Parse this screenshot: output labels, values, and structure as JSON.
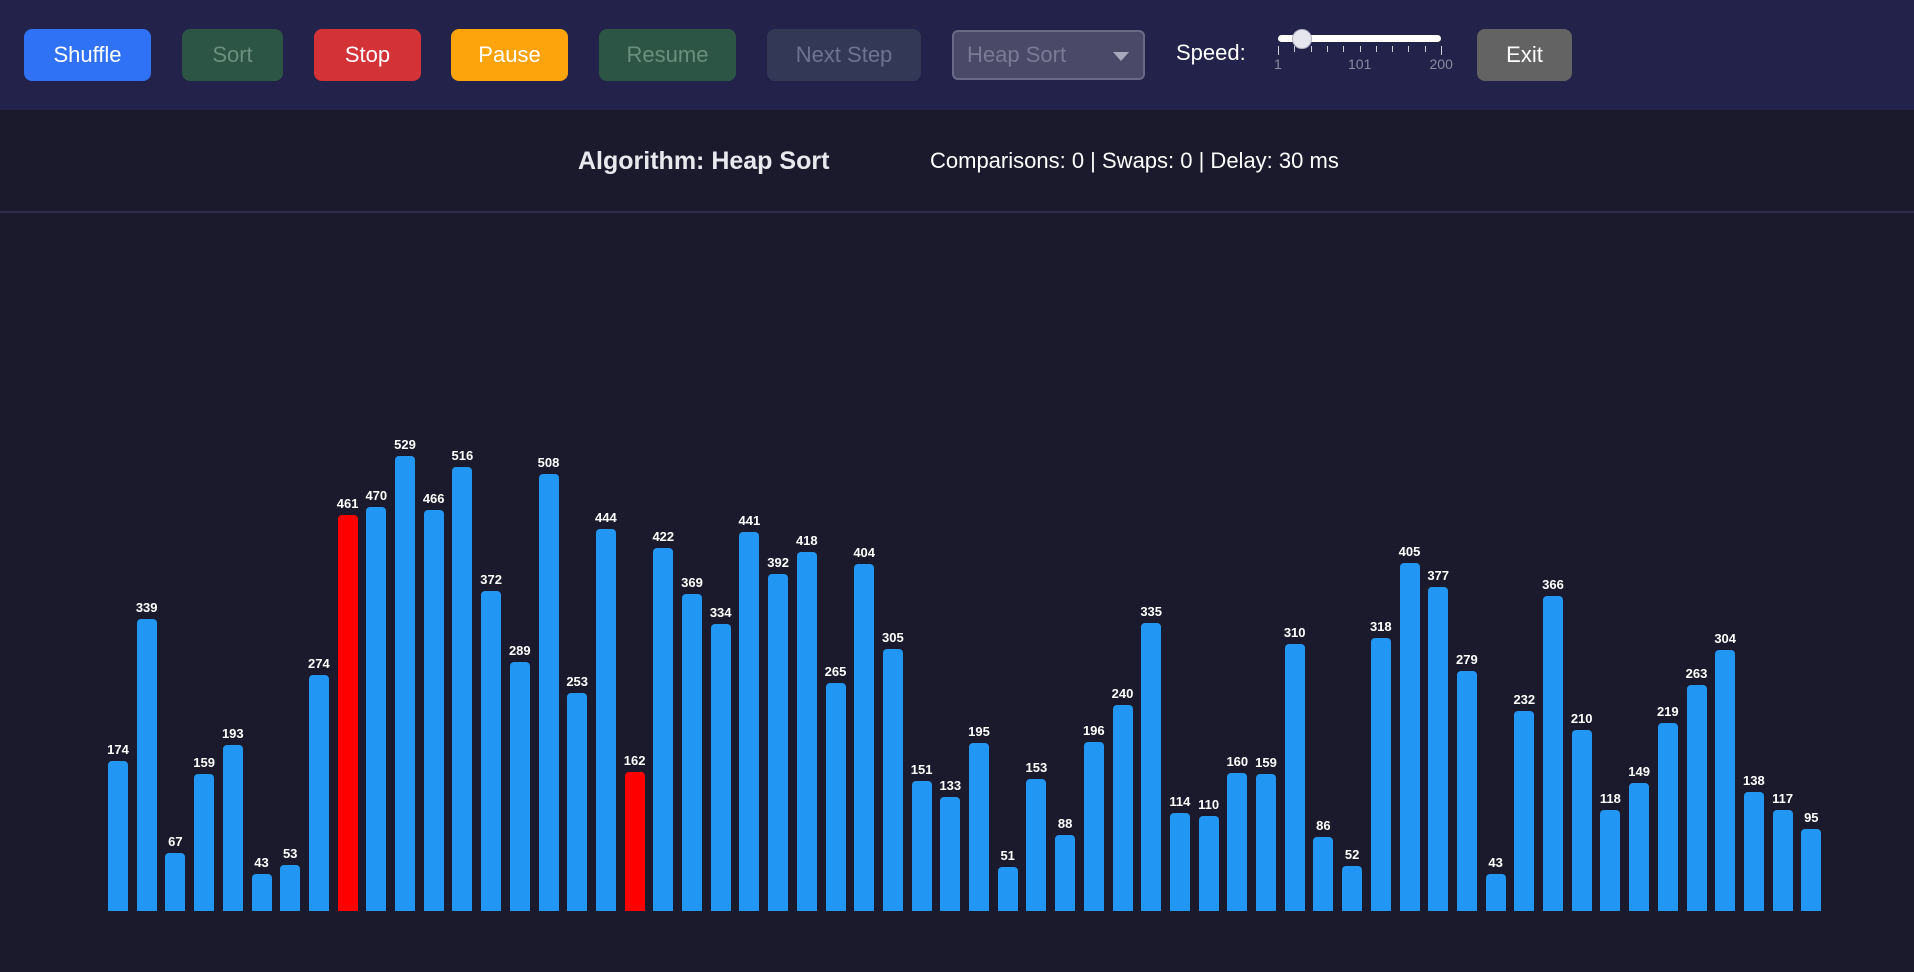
{
  "toolbar": {
    "shuffle": {
      "label": "Shuffle",
      "bg": "#3072f5",
      "color": "#ffffff"
    },
    "sort": {
      "label": "Sort",
      "bg": "#2c5545",
      "color": "#6a8f7e"
    },
    "stop": {
      "label": "Stop",
      "bg": "#d33236",
      "color": "#ffffff"
    },
    "pause": {
      "label": "Pause",
      "bg": "#fda30c",
      "color": "#ffffff"
    },
    "resume": {
      "label": "Resume",
      "bg": "#2c5545",
      "color": "#6a8f7e"
    },
    "next_step": {
      "label": "Next Step",
      "bg": "#333856",
      "color": "#6e7390"
    },
    "algorithm_select": {
      "value": "Heap Sort"
    },
    "speed": {
      "label": "Speed:",
      "value": 30,
      "min": 1,
      "max": 200,
      "tick_labels": [
        "1",
        "101",
        "200"
      ]
    },
    "exit": {
      "label": "Exit",
      "bg": "#636363",
      "color": "#ffffff"
    }
  },
  "info": {
    "algorithm": "Algorithm: Heap Sort",
    "stats": "Comparisons: 0 | Swaps: 0 | Delay: 30 ms"
  },
  "colors": {
    "bar": "#2196f3",
    "highlight": "#ff0000"
  },
  "bars": [
    174,
    339,
    67,
    159,
    193,
    43,
    53,
    274,
    461,
    470,
    529,
    466,
    516,
    372,
    289,
    508,
    253,
    444,
    162,
    422,
    369,
    334,
    441,
    392,
    418,
    265,
    404,
    305,
    151,
    133,
    195,
    51,
    153,
    88,
    196,
    240,
    335,
    114,
    110,
    160,
    159,
    310,
    86,
    52,
    318,
    405,
    377,
    279,
    43,
    232,
    366,
    210,
    118,
    149,
    219,
    263,
    304,
    138,
    117,
    95
  ],
  "highlighted_indices": [
    8,
    18
  ]
}
